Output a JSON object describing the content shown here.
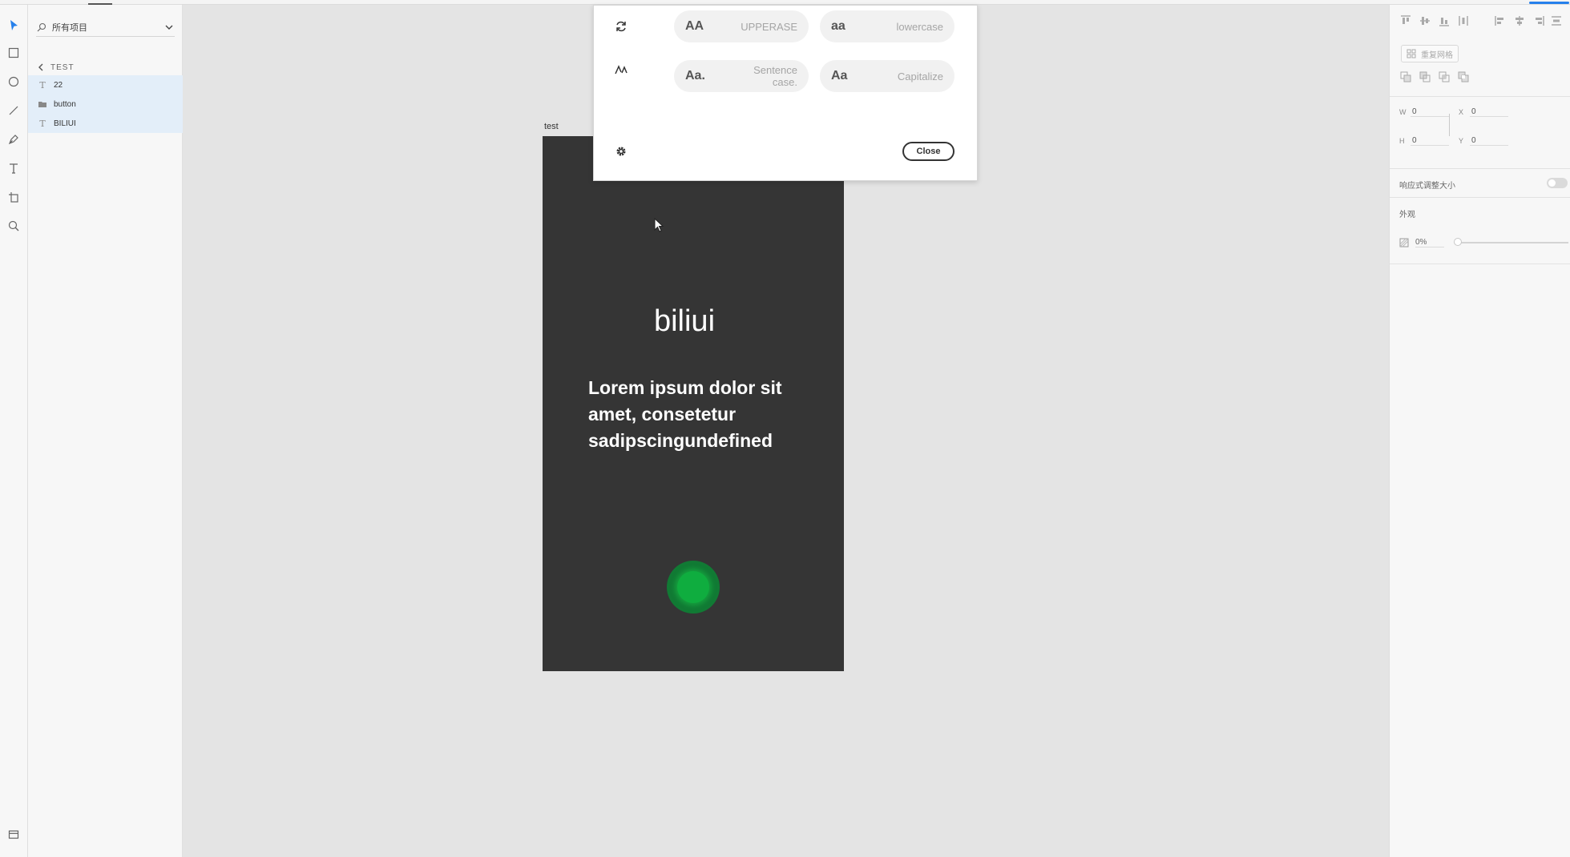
{
  "layers_panel": {
    "search_placeholder": "所有项目",
    "group_name": "TEST",
    "layers": [
      {
        "name": "22",
        "type": "text"
      },
      {
        "name": "button",
        "type": "group"
      },
      {
        "name": "BILIUI",
        "type": "text"
      }
    ]
  },
  "canvas": {
    "artboard_label": "test",
    "title_text": "biliui",
    "body_text": "Lorem ipsum dolor sit amet, consetetur sadipscingundefined"
  },
  "case_dialog": {
    "options": [
      {
        "sample": "AA",
        "label": "UPPERASE"
      },
      {
        "sample": "aa",
        "label": "lowercase"
      },
      {
        "sample": "Aa.",
        "label": "Sentence case."
      },
      {
        "sample": "Aa",
        "label": "Capitalize"
      }
    ],
    "close_label": "Close"
  },
  "properties": {
    "repeat_grid_label": "重复网格",
    "w_label": "W",
    "w_value": "0",
    "x_label": "X",
    "x_value": "0",
    "h_label": "H",
    "h_value": "0",
    "y_label": "Y",
    "y_value": "0",
    "responsive_resize_label": "响应式调整大小",
    "appearance_label": "外观",
    "opacity_value": "0%"
  },
  "colors": {
    "artboard_bg": "#353535",
    "button_green": "#0fad3f",
    "selection_bg": "#e3eef9",
    "accent_blue": "#2680eb"
  }
}
